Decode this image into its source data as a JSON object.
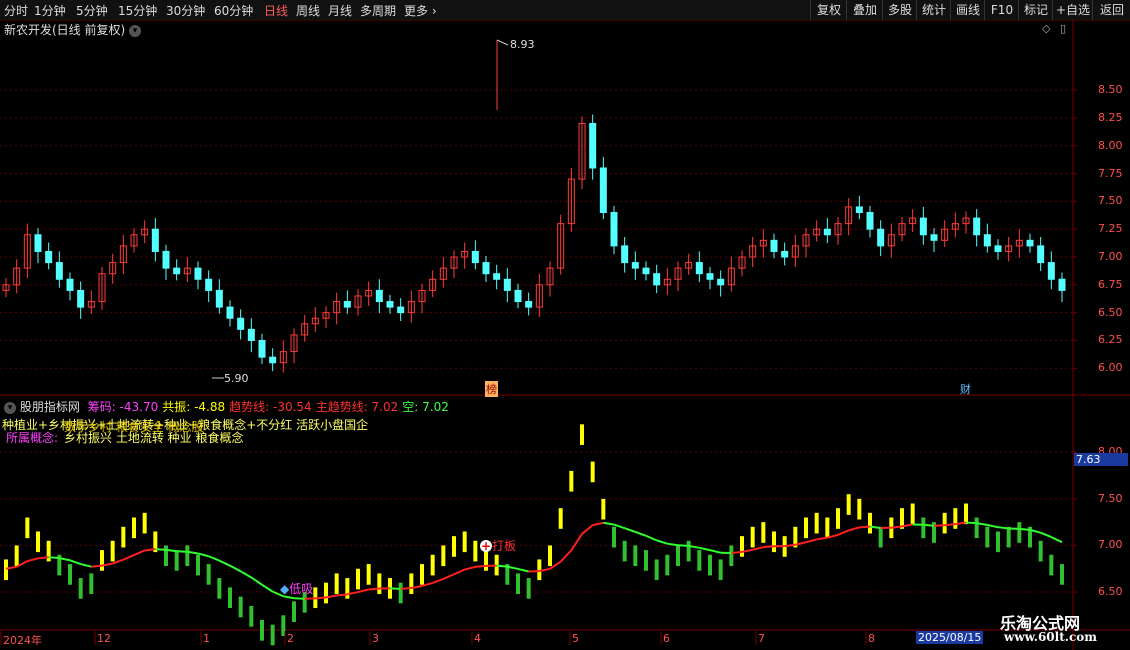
{
  "toolbar": {
    "periods": [
      "分时",
      "1分钟",
      "5分钟",
      "15分钟",
      "30分钟",
      "60分钟",
      "日线",
      "周线",
      "月线",
      "多周期",
      "更多"
    ],
    "right_buttons": [
      "复权",
      "叠加",
      "多股",
      "统计",
      "画线",
      "F10",
      "标记",
      "+自选",
      "返回"
    ]
  },
  "main_panel": {
    "title": "新农开发(日线 前复权)",
    "y_ticks": [
      "8.50",
      "8.25",
      "8.00",
      "7.75",
      "7.50",
      "7.25",
      "7.00",
      "6.75",
      "6.50",
      "6.25",
      "6.00"
    ],
    "high_label": "8.93",
    "low_label": "5.90",
    "marker_bang": "榜",
    "marker_cai": "财"
  },
  "indicator_panel": {
    "name": "股朋指标网",
    "stats": [
      {
        "label": "筹码:",
        "value": "-43.70",
        "color": "#ff40ff"
      },
      {
        "label": "共振:",
        "value": "-4.88",
        "color": "#ffff00"
      },
      {
        "label": "趋势线:",
        "value": "-30.54",
        "color": "#ff3030"
      },
      {
        "label": "主趋势线:",
        "value": "7.02",
        "color": "#ff3030"
      },
      {
        "label": "空:",
        "value": "7.02",
        "color": "#40ff40"
      }
    ],
    "overlap_line1": "种植业+乡村振兴+土地流转+种业+粮食概念+不分红 活跃小盘国企",
    "overlap_line1b": "数字乡村 粮食安全 概念股",
    "overlap_label2": "所属概念:",
    "overlap_line2": "乡村振兴 土地流转 种业 粮食概念",
    "y_ticks": [
      "8.00",
      "7.50",
      "7.00",
      "6.50"
    ],
    "current_value": "7.63",
    "signal_buy": "低吸",
    "signal_board": "打板"
  },
  "date_axis": {
    "labels": [
      "2024年",
      "12",
      "1",
      "2",
      "3",
      "4",
      "5",
      "6",
      "7",
      "8"
    ],
    "current_date": "2025/08/15"
  },
  "watermark": {
    "site_name": "乐淘公式网",
    "url": "www.60lt.com"
  },
  "chart_data": {
    "type": "candlestick",
    "close_series": [
      6.75,
      6.9,
      7.2,
      7.05,
      6.95,
      6.8,
      6.7,
      6.55,
      6.6,
      6.85,
      6.95,
      7.1,
      7.2,
      7.25,
      7.05,
      6.9,
      6.85,
      6.9,
      6.8,
      6.7,
      6.55,
      6.45,
      6.35,
      6.25,
      6.1,
      6.05,
      6.15,
      6.3,
      6.4,
      6.45,
      6.5,
      6.6,
      6.55,
      6.65,
      6.7,
      6.6,
      6.55,
      6.5,
      6.6,
      6.7,
      6.8,
      6.9,
      7.0,
      7.05,
      6.95,
      6.85,
      6.8,
      6.7,
      6.6,
      6.55,
      6.75,
      6.9,
      7.3,
      7.7,
      8.2,
      7.8,
      7.4,
      7.1,
      6.95,
      6.9,
      6.85,
      6.75,
      6.8,
      6.9,
      6.95,
      6.85,
      6.8,
      6.75,
      6.9,
      7.0,
      7.1,
      7.15,
      7.05,
      7.0,
      7.1,
      7.2,
      7.25,
      7.2,
      7.3,
      7.45,
      7.4,
      7.25,
      7.1,
      7.2,
      7.3,
      7.35,
      7.2,
      7.15,
      7.25,
      7.3,
      7.35,
      7.2,
      7.1,
      7.05,
      7.1,
      7.15,
      7.1,
      6.95,
      6.8,
      6.7
    ],
    "price_range": [
      5.85,
      8.95
    ]
  }
}
